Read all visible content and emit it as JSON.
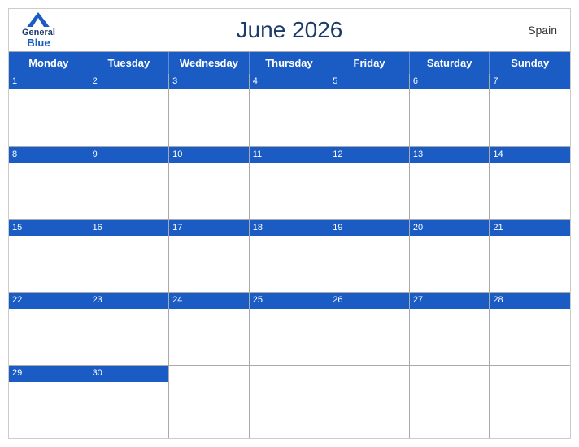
{
  "header": {
    "title": "June 2026",
    "country": "Spain",
    "logo": {
      "general": "General",
      "blue": "Blue"
    }
  },
  "days_of_week": [
    "Monday",
    "Tuesday",
    "Wednesday",
    "Thursday",
    "Friday",
    "Saturday",
    "Sunday"
  ],
  "weeks": [
    [
      {
        "date": "1",
        "empty": false
      },
      {
        "date": "2",
        "empty": false
      },
      {
        "date": "3",
        "empty": false
      },
      {
        "date": "4",
        "empty": false
      },
      {
        "date": "5",
        "empty": false
      },
      {
        "date": "6",
        "empty": false
      },
      {
        "date": "7",
        "empty": false
      }
    ],
    [
      {
        "date": "8",
        "empty": false
      },
      {
        "date": "9",
        "empty": false
      },
      {
        "date": "10",
        "empty": false
      },
      {
        "date": "11",
        "empty": false
      },
      {
        "date": "12",
        "empty": false
      },
      {
        "date": "13",
        "empty": false
      },
      {
        "date": "14",
        "empty": false
      }
    ],
    [
      {
        "date": "15",
        "empty": false
      },
      {
        "date": "16",
        "empty": false
      },
      {
        "date": "17",
        "empty": false
      },
      {
        "date": "18",
        "empty": false
      },
      {
        "date": "19",
        "empty": false
      },
      {
        "date": "20",
        "empty": false
      },
      {
        "date": "21",
        "empty": false
      }
    ],
    [
      {
        "date": "22",
        "empty": false
      },
      {
        "date": "23",
        "empty": false
      },
      {
        "date": "24",
        "empty": false
      },
      {
        "date": "25",
        "empty": false
      },
      {
        "date": "26",
        "empty": false
      },
      {
        "date": "27",
        "empty": false
      },
      {
        "date": "28",
        "empty": false
      }
    ],
    [
      {
        "date": "29",
        "empty": false
      },
      {
        "date": "30",
        "empty": false
      },
      {
        "date": "",
        "empty": true
      },
      {
        "date": "",
        "empty": true
      },
      {
        "date": "",
        "empty": true
      },
      {
        "date": "",
        "empty": true
      },
      {
        "date": "",
        "empty": true
      }
    ]
  ]
}
